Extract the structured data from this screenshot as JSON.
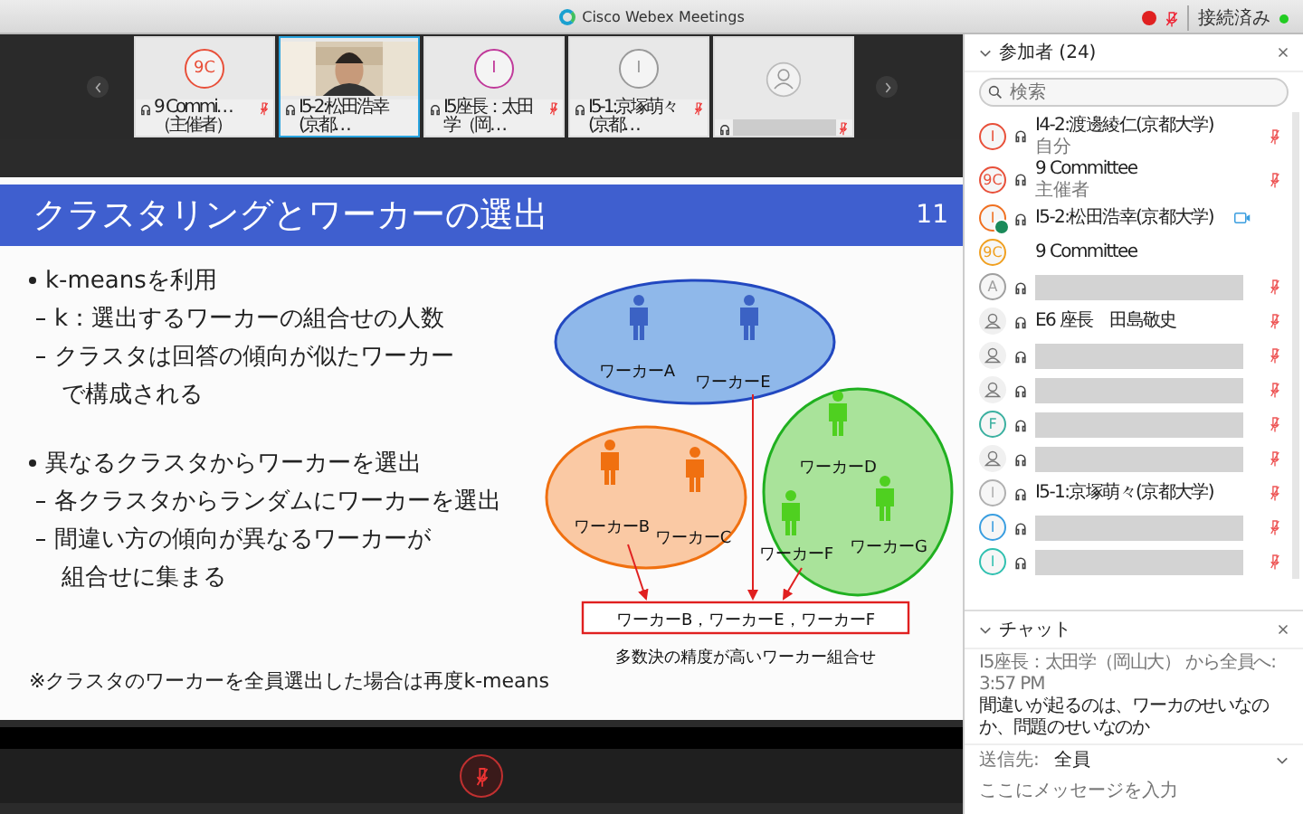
{
  "window": {
    "title": "Cisco Webex Meetings",
    "status": "接続済み"
  },
  "video_strip": [
    {
      "kind": "initials",
      "avatar": "9C",
      "color": "#e8503a",
      "name": "9 Commi…",
      "role": "（主催者）",
      "muted": true,
      "selected": false
    },
    {
      "kind": "video",
      "name": "I5-2:松田浩幸(京都…",
      "muted": false,
      "selected": true
    },
    {
      "kind": "initials",
      "avatar": "I",
      "color": "#c0399a",
      "name": "I5座長：太田学（岡…",
      "muted": true,
      "selected": false
    },
    {
      "kind": "initials",
      "avatar": "I",
      "color": "#9a9a9a",
      "name": "I5-1:京塚萌々(京都…",
      "muted": true,
      "selected": false
    },
    {
      "kind": "person",
      "redacted": true,
      "muted": true,
      "selected": false
    }
  ],
  "slide": {
    "title": "クラスタリングとワーカーの選出",
    "page": "11",
    "bullets": [
      {
        "kind": "main",
        "text": "k-meansを利用"
      },
      {
        "kind": "sub",
        "text": "k：選出するワーカーの組合せの人数"
      },
      {
        "kind": "sub",
        "text": "クラスタは回答の傾向が似たワーカー"
      },
      {
        "kind": "cont",
        "text": "で構成される"
      },
      {
        "kind": "gap"
      },
      {
        "kind": "main",
        "text": "異なるクラスタからワーカーを選出"
      },
      {
        "kind": "sub",
        "text": "各クラスタからランダムにワーカーを選出"
      },
      {
        "kind": "sub",
        "text": "間違い方の傾向が異なるワーカーが"
      },
      {
        "kind": "cont",
        "text": "組合せに集まる"
      }
    ],
    "note": "※クラスタのワーカーを全員選出した場合は再度k-means",
    "workers": [
      {
        "label": "ワーカーA",
        "color": "#3b62c4"
      },
      {
        "label": "ワーカーE",
        "color": "#3b62c4"
      },
      {
        "label": "ワーカーB",
        "color": "#f07010"
      },
      {
        "label": "ワーカーC",
        "color": "#f07010"
      },
      {
        "label": "ワーカーD",
        "color": "#4fd020"
      },
      {
        "label": "ワーカーF",
        "color": "#4fd020"
      },
      {
        "label": "ワーカーG",
        "color": "#4fd020"
      }
    ],
    "result": "ワーカーB，ワーカーE，ワーカーF",
    "caption": "多数決の精度が高いワーカー組合せ"
  },
  "participants": {
    "title": "参加者 (24)",
    "search_placeholder": "検索",
    "items": [
      {
        "kind": "initials",
        "avatar": "I",
        "color": "#e8503a",
        "name": "I4-2:渡邊綾仁(京都大学)",
        "role": "自分",
        "audio": true,
        "muted": true,
        "video": false,
        "presenter": false
      },
      {
        "kind": "initials",
        "avatar": "9C",
        "color": "#e8503a",
        "name": "9 Committee",
        "role": "主催者",
        "audio": true,
        "muted": true,
        "video": false,
        "presenter": false
      },
      {
        "kind": "initials",
        "avatar": "I",
        "color": "#f07020",
        "name": "I5-2:松田浩幸(京都大学)",
        "audio": true,
        "muted": false,
        "video": true,
        "presenter": true
      },
      {
        "kind": "initials",
        "avatar": "9C",
        "color": "#f0a020",
        "name": "9 Committee",
        "audio": false,
        "muted": false,
        "video": false,
        "presenter": false
      },
      {
        "kind": "initials",
        "avatar": "A",
        "color": "#a0a0a0",
        "redacted": true,
        "audio": true,
        "muted": true,
        "video": false,
        "presenter": false
      },
      {
        "kind": "person",
        "name": "E6 座長　田島敬史",
        "audio": true,
        "muted": true,
        "video": false,
        "presenter": false
      },
      {
        "kind": "person",
        "redacted": true,
        "audio": true,
        "muted": true,
        "video": false,
        "presenter": false
      },
      {
        "kind": "person",
        "redacted": true,
        "audio": true,
        "muted": true,
        "video": false,
        "presenter": false
      },
      {
        "kind": "initials",
        "avatar": "F",
        "color": "#3bb0a0",
        "redacted": true,
        "audio": true,
        "muted": true,
        "video": false,
        "presenter": false
      },
      {
        "kind": "person",
        "redacted": true,
        "audio": true,
        "muted": true,
        "video": false,
        "presenter": false
      },
      {
        "kind": "initials",
        "avatar": "I",
        "color": "#b0b0b0",
        "name": "I5-1:京塚萌々(京都大学)",
        "audio": true,
        "muted": true,
        "video": false,
        "presenter": false
      },
      {
        "kind": "initials",
        "avatar": "I",
        "color": "#3a9ee0",
        "redacted": true,
        "audio": true,
        "muted": true,
        "video": false,
        "presenter": false
      },
      {
        "kind": "initials",
        "avatar": "I",
        "color": "#30c0b0",
        "redacted": true,
        "audio": true,
        "muted": true,
        "video": false,
        "presenter": false
      }
    ]
  },
  "chat": {
    "title": "チャット",
    "sender": "I5座長：太田学（岡山大） から全員へ:",
    "time": "3:57 PM",
    "message": "間違いが起るのは、ワーカのせいなのか、問題のせいなのか",
    "to_label": "送信先:",
    "to": "全員",
    "placeholder": "ここにメッセージを入力"
  }
}
